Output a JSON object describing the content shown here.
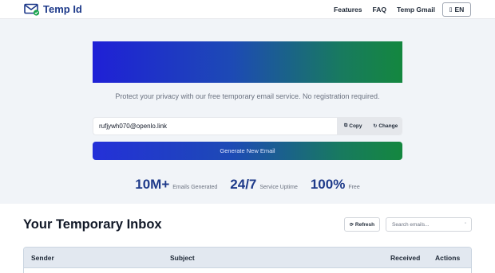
{
  "header": {
    "brand": "Temp Id",
    "nav": [
      "Features",
      "FAQ",
      "Temp Gmail"
    ],
    "language": "EN"
  },
  "hero": {
    "tagline": "Protect your privacy with our free temporary email service. No registration required.",
    "email": "rufjywh070@openlo.link",
    "copy_label": "Copy",
    "change_label": "Change",
    "generate_label": "Generate New Email"
  },
  "stats": [
    {
      "value": "10M+",
      "label": "Emails Generated"
    },
    {
      "value": "24/7",
      "label": "Service Uptime"
    },
    {
      "value": "100%",
      "label": "Free"
    }
  ],
  "inbox": {
    "title": "Your Temporary Inbox",
    "refresh_label": "Refresh",
    "search_placeholder": "Search emails...",
    "columns": [
      "Sender",
      "Subject",
      "Received",
      "Actions"
    ]
  },
  "colors": {
    "brand": "#1e3a8a",
    "gradient_start": "#1f20d6",
    "gradient_end": "#14873f"
  },
  "icons": {
    "logo": "envelope-check-icon",
    "copy": "copy-icon",
    "change": "refresh-icon",
    "refresh": "refresh-icon",
    "search": "search-icon",
    "language": "flag-icon"
  }
}
